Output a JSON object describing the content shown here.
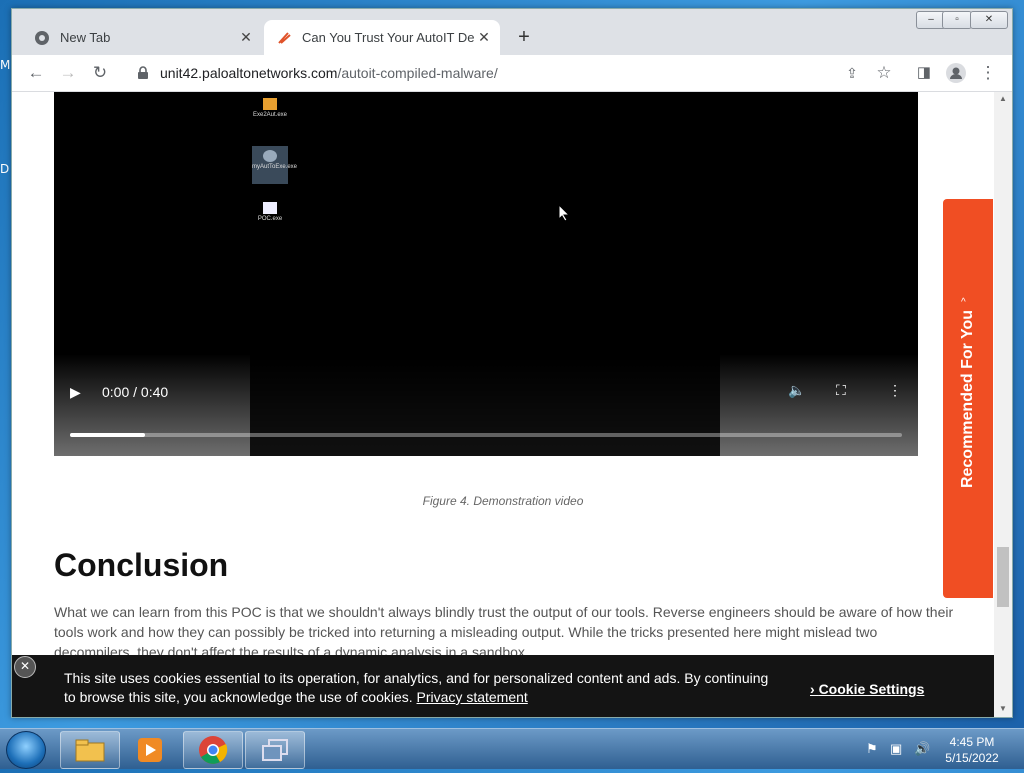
{
  "desktop": {
    "label_top": "M",
    "label_mid": "D"
  },
  "browser": {
    "tabs": [
      {
        "title": "New Tab",
        "icon": "chrome-icon"
      },
      {
        "title": "Can You Trust Your AutoIT Decom",
        "icon": "unit42-icon"
      }
    ],
    "window_controls": {
      "minimize": "–",
      "maximize": "▫",
      "close": "✕"
    },
    "url_host": "unit42.paloaltonetworks.com",
    "url_path": "/autoit-compiled-malware/"
  },
  "video": {
    "time": "0:00 / 0:40",
    "progress_fraction": 0.09,
    "desktop_icons": [
      "Exe2Aut.exe",
      "myAutToExe.exe",
      "POC.exe"
    ]
  },
  "article": {
    "caption": "Figure 4. Demonstration video",
    "heading": "Conclusion",
    "paragraph": "What we can learn from this POC is that we shouldn't always blindly trust the output of our tools. Reverse engineers should be aware of how their tools work and how they can possibly be tricked into returning a misleading output. While the tricks presented here might mislead two decompilers, they don't affect the results of a dynamic analysis in a sandbox."
  },
  "recommended": {
    "label": "Recommended For You",
    "caret": "^"
  },
  "cookie": {
    "message": "This site uses cookies essential to its operation, for analytics, and for personalized content and ads. By continuing to browse this site, you acknowledge the use of cookies.",
    "privacy_link": "Privacy statement",
    "settings": "Cookie Settings",
    "close": "✕"
  },
  "taskbar": {
    "time": "4:45 PM",
    "date": "5/15/2022"
  },
  "colors": {
    "accent": "#f04e23",
    "cookie_bg": "#141414"
  }
}
